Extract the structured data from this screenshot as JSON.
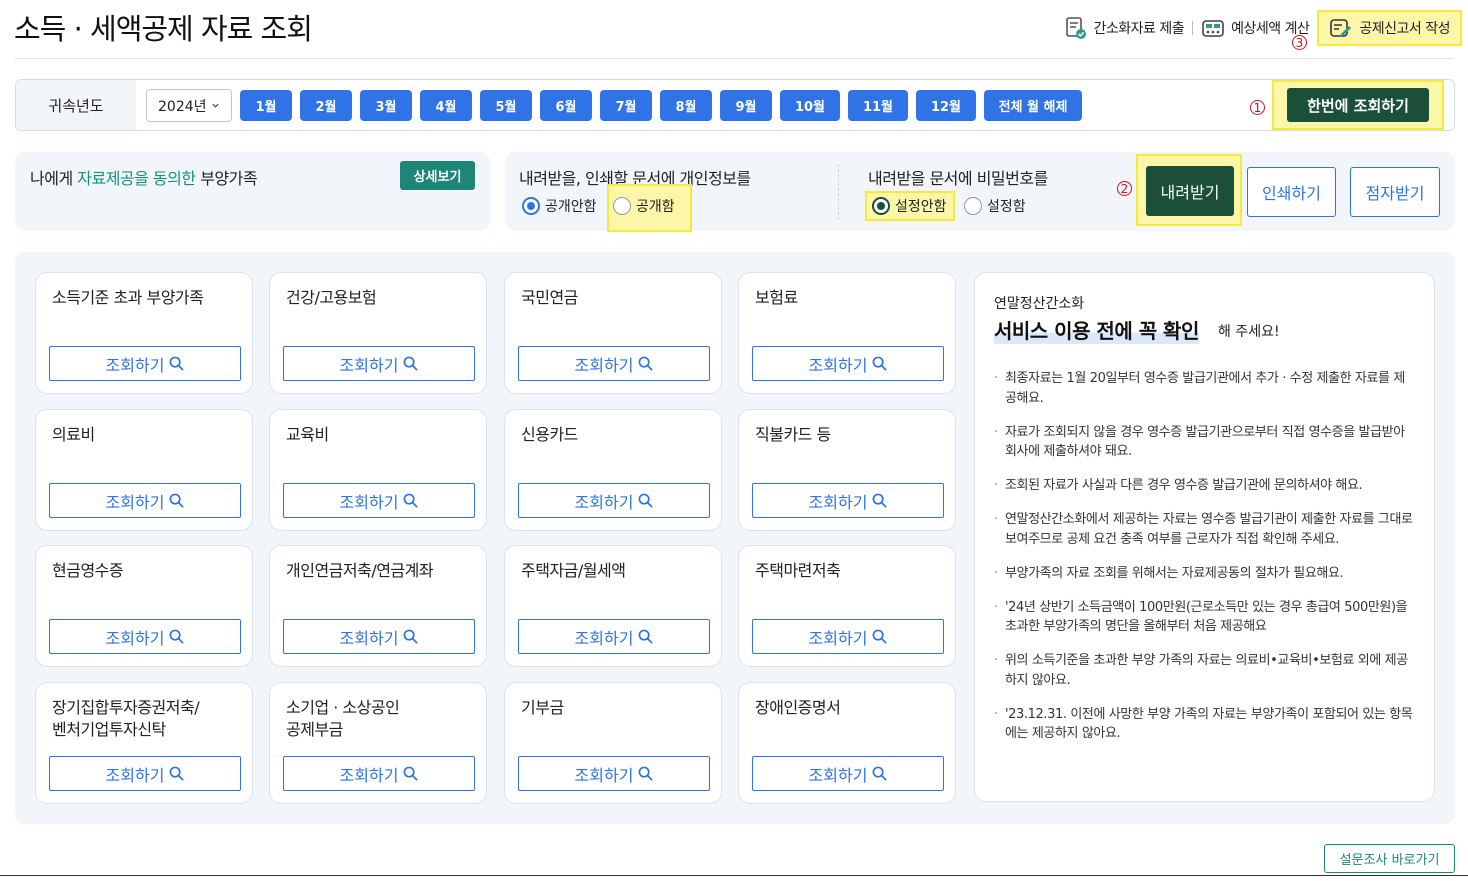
{
  "page": {
    "title": "소득 · 세액공제 자료 조회"
  },
  "top_links": [
    {
      "label": "간소화자료 제출",
      "icon": "doc-check-icon"
    },
    {
      "label": "예상세액 계산",
      "icon": "calculator-icon"
    },
    {
      "label": "공제신고서 작성",
      "icon": "doc-edit-icon"
    }
  ],
  "markers": {
    "one": "1",
    "two": "2",
    "three": "3"
  },
  "year_bar": {
    "label": "귀속년도",
    "selected_year": "2024년",
    "months": [
      "1월",
      "2월",
      "3월",
      "4월",
      "5월",
      "6월",
      "7월",
      "8월",
      "9월",
      "10월",
      "11월",
      "12월"
    ],
    "clear_all": "전체 월 해제",
    "lookup_all": "한번에 조회하기"
  },
  "consent": {
    "prefix": "나에게 ",
    "highlight": "자료제공을 동의한",
    "suffix": " 부양가족",
    "detail_button": "상세보기"
  },
  "privacy_option": {
    "title": "내려받을, 인쇄할 문서에 개인정보를",
    "options": [
      "공개안함",
      "공개함"
    ],
    "selected": "공개안함"
  },
  "password_option": {
    "title": "내려받을 문서에 비밀번호를",
    "options": [
      "설정안함",
      "설정함"
    ],
    "selected": "설정안함"
  },
  "actions": {
    "download": "내려받기",
    "print": "인쇄하기",
    "braille": "점자받기"
  },
  "lookup_label": "조회하기",
  "cards": [
    "소득기준 초과 부양가족",
    "건강/고용보험",
    "국민연금",
    "보험료",
    "의료비",
    "교육비",
    "신용카드",
    "직불카드 등",
    "현금영수증",
    "개인연금저축/연금계좌",
    "주택자금/월세액",
    "주택마련저축",
    "장기집합투자증권저축/\n벤처기업투자신탁",
    "소기업 · 소상공인\n공제부금",
    "기부금",
    "장애인증명서"
  ],
  "notice": {
    "subtitle": "연말정산간소화",
    "title": "서비스 이용 전에 꼭 확인",
    "title_tail": "해 주세요!",
    "items": [
      "최종자료는 1월 20일부터 영수증 발급기관에서 추가 · 수정 제출한 자료를 제공해요.",
      "자료가 조회되지 않을 경우 영수증 발급기관으로부터 직접 영수증을 발급받아 회사에 제출하셔야 돼요.",
      "조회된 자료가 사실과 다른 경우 영수증 발급기관에 문의하셔야 해요.",
      "연말정산간소화에서 제공하는 자료는 영수증 발급기관이 제출한 자료를 그대로 보여주므로 공제 요건 충족 여부를 근로자가 직접 확인해 주세요.",
      "부양가족의 자료 조회를 위해서는 자료제공동의 절차가 필요해요.",
      "'24년 상반기 소득금액이 100만원(근로소득만 있는 경우 총급여 500만원)을 초과한 부양가족의 명단을 올해부터 처음 제공해요",
      "위의 소득기준을 초과한 부양 가족의 자료는 의료비•교육비•보험료 외에 제공하지 않아요.",
      "'23.12.31. 이전에 사망한 부양 가족의 자료는 부양가족이 포함되어 있는 항목에는 제공하지 않아요."
    ]
  },
  "survey_button": "설문조사 바로가기",
  "colors": {
    "primary_blue": "#2f73e6",
    "dark_green": "#1b4f3a",
    "teal": "#1d8676",
    "highlight_yellow": "#fcf7a8",
    "marker_red": "#d0121b"
  }
}
